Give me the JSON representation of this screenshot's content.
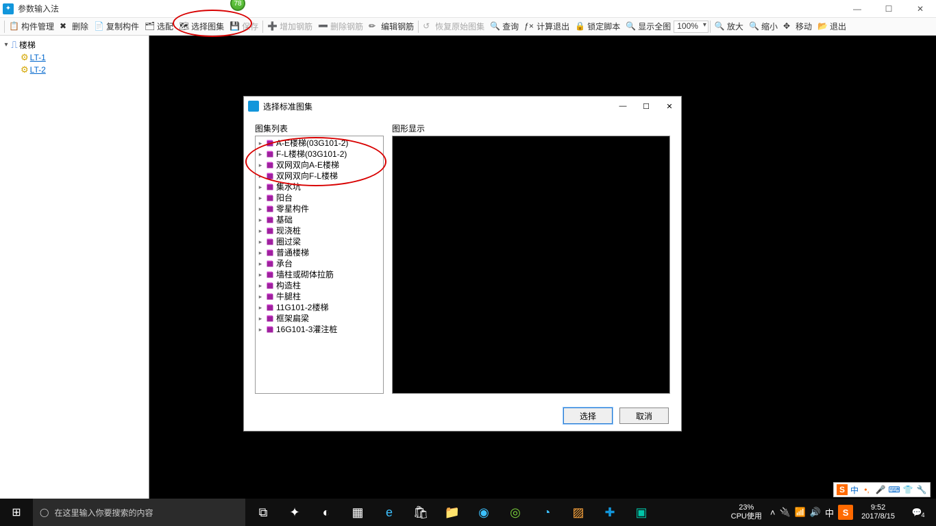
{
  "titlebar": {
    "title": "参数输入法",
    "badge": "78"
  },
  "toolbar": {
    "items": [
      "构件管理",
      "删除",
      "复制构件",
      "选配",
      "选择图集",
      "保存",
      "增加钢筋",
      "删除钢筋",
      "编辑钢筋",
      "恢复原始图集",
      "查询",
      "计算退出",
      "锁定脚本",
      "显示全图"
    ],
    "zoom": "100%",
    "right_items": [
      "放大",
      "缩小",
      "移动",
      "退出"
    ]
  },
  "tree": {
    "root": "楼梯",
    "children": [
      "LT-1",
      "LT-2"
    ]
  },
  "dialog": {
    "title": "选择标准图集",
    "left_label": "图集列表",
    "right_label": "图形显示",
    "items": [
      "A-E楼梯(03G101-2)",
      "F-L楼梯(03G101-2)",
      "双网双向A-E楼梯",
      "双网双向F-L楼梯",
      "集水坑",
      "阳台",
      "零星构件",
      "基础",
      "现浇桩",
      "圈过梁",
      "普通楼梯",
      "承台",
      "墙柱或砌体拉筋",
      "构造柱",
      "牛腿柱",
      "11G101-2楼梯",
      "框架扁梁",
      "16G101-3灌注桩"
    ],
    "select_btn": "选择",
    "cancel_btn": "取消"
  },
  "taskbar": {
    "search_placeholder": "在这里输入你要搜索的内容",
    "cpu_pct": "23%",
    "cpu_label": "CPU使用",
    "time": "9:52",
    "date": "2017/8/15",
    "ime": "中",
    "notif_count": "4"
  },
  "ime_strip": {
    "lang": "中",
    "s": "S"
  }
}
